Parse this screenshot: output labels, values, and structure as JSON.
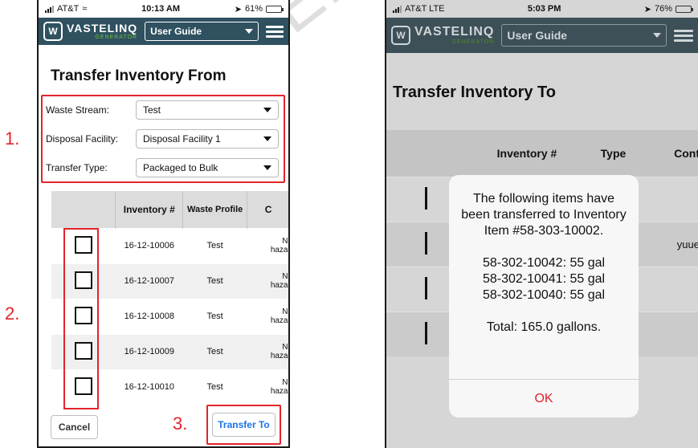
{
  "watermark": "SER G",
  "steps": [
    "1.",
    "2.",
    "3."
  ],
  "left_phone": {
    "status": {
      "carrier": "AT&T",
      "time": "10:13 AM",
      "battery": "61%",
      "battery_level": 0.61
    },
    "app_bar": {
      "brand": "VASTELINQ",
      "brand_sub": "GENERATOR",
      "guide_select": "User Guide"
    },
    "title": "Transfer Inventory From",
    "form": {
      "rows": [
        {
          "label": "Waste Stream:",
          "value": "Test"
        },
        {
          "label": "Disposal Facility:",
          "value": "Disposal Facility 1"
        },
        {
          "label": "Transfer Type:",
          "value": "Packaged to Bulk"
        }
      ]
    },
    "table": {
      "headers": [
        "Inventory #",
        "Waste Profile",
        "C"
      ],
      "rows": [
        {
          "inventory": "16-12-10006",
          "profile": "Test",
          "clip1": "N",
          "clip2": "haza"
        },
        {
          "inventory": "16-12-10007",
          "profile": "Test",
          "clip1": "N",
          "clip2": "haza"
        },
        {
          "inventory": "16-12-10008",
          "profile": "Test",
          "clip1": "N",
          "clip2": "haza"
        },
        {
          "inventory": "16-12-10009",
          "profile": "Test",
          "clip1": "N",
          "clip2": "haza"
        },
        {
          "inventory": "16-12-10010",
          "profile": "Test",
          "clip1": "N",
          "clip2": "haza"
        }
      ]
    },
    "buttons": {
      "cancel": "Cancel",
      "transfer": "Transfer To"
    }
  },
  "right_phone": {
    "status": {
      "carrier": "AT&T  LTE",
      "time": "5:03 PM",
      "battery": "76%",
      "battery_level": 0.76
    },
    "app_bar": {
      "brand": "VASTELINQ",
      "brand_sub": "GENERATOR",
      "guide_select": "User Guide"
    },
    "title": "Transfer Inventory To",
    "table": {
      "headers": [
        "Inventory #",
        "Type",
        "Cont"
      ],
      "row_fragment": "yuue"
    },
    "modal": {
      "line1": "The following items have",
      "line2": "been transferred to Inventory",
      "line3": "Item #58-303-10002.",
      "item1": "58-302-10042: 55 gal",
      "item2": "58-302-10041: 55 gal",
      "item3": "58-302-10040: 55 gal",
      "total": "Total: 165.0 gallons.",
      "ok": "OK"
    }
  }
}
